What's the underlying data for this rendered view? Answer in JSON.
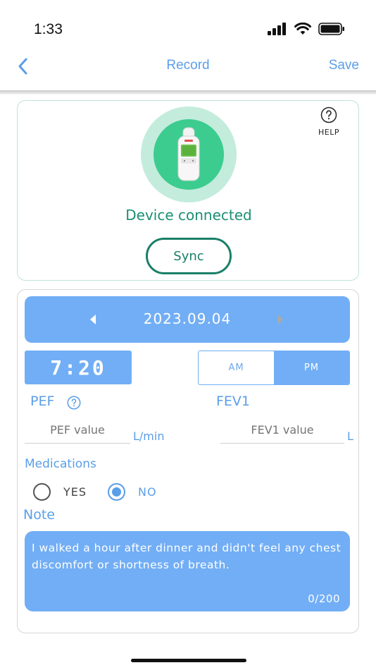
{
  "status_bar": {
    "time": "1:33"
  },
  "nav": {
    "title": "Record",
    "save_label": "Save"
  },
  "device": {
    "status": "Device connected",
    "sync_label": "Sync",
    "help_label": "HELP"
  },
  "record": {
    "date": "2023.09.04",
    "time": "7:20",
    "am_label": "AM",
    "pm_label": "PM",
    "selected_period": "PM",
    "pef": {
      "label": "PEF",
      "placeholder": "PEF value",
      "unit": "L/min"
    },
    "fev1": {
      "label": "FEV1",
      "placeholder": "FEV1 value",
      "unit": "L"
    },
    "medications": {
      "label": "Medications",
      "yes_label": "YES",
      "no_label": "NO",
      "selected": "NO"
    },
    "note": {
      "label": "Note",
      "text": "I walked a hour after dinner and didn't  feel any chest discomfort or shortness of breath.",
      "counter": "0/200"
    }
  },
  "colors": {
    "accent_blue": "#72aef5",
    "text_blue": "#5b9ee8",
    "device_green": "#3ccc8f",
    "halo_green": "#c3ecdd",
    "sync_green": "#1a7f68"
  }
}
